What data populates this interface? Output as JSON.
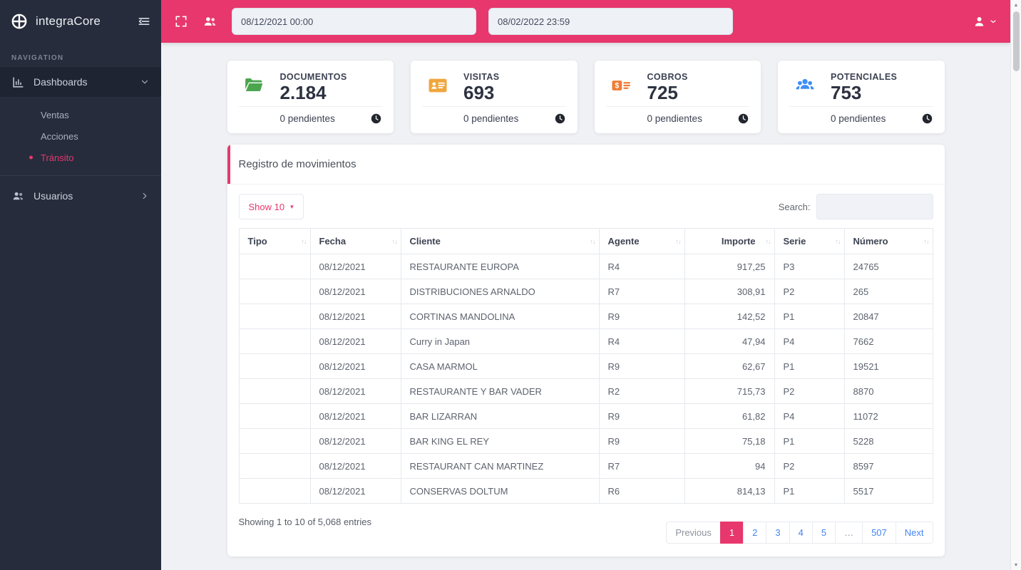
{
  "colors": {
    "accent": "#e7376c",
    "sidebar": "#262c3c",
    "green": "#4ba64f",
    "amber": "#f0a63c",
    "orange": "#ee7d35",
    "blue": "#3e8ef7",
    "link": "#4285f4"
  },
  "sidebar": {
    "brand": "integraCore",
    "section_label": "NAVIGATION",
    "dashboards": {
      "label": "Dashboards"
    },
    "submenu": [
      {
        "label": "Ventas"
      },
      {
        "label": "Acciones"
      },
      {
        "label": "Tránsito"
      }
    ],
    "usuarios": {
      "label": "Usuarios"
    }
  },
  "topbar": {
    "date_from": "08/12/2021 00:00",
    "date_to": "08/02/2022 23:59"
  },
  "stats": [
    {
      "title": "DOCUMENTOS",
      "value": "2.184",
      "pending": "0 pendientes",
      "icon": "folder-icon"
    },
    {
      "title": "VISITAS",
      "value": "693",
      "pending": "0 pendientes",
      "icon": "id-card-icon"
    },
    {
      "title": "COBROS",
      "value": "725",
      "pending": "0 pendientes",
      "icon": "money-icon"
    },
    {
      "title": "POTENCIALES",
      "value": "753",
      "pending": "0 pendientes",
      "icon": "users-group-icon"
    }
  ],
  "panel": {
    "title": "Registro de movimientos",
    "show_button": "Show 10",
    "search_label": "Search:",
    "table": {
      "columns": [
        "Tipo",
        "Fecha",
        "Cliente",
        "Agente",
        "Importe",
        "Serie",
        "Número"
      ],
      "rows": [
        [
          "",
          "08/12/2021",
          "RESTAURANTE EUROPA",
          "R4",
          "917,25",
          "P3",
          "24765"
        ],
        [
          "",
          "08/12/2021",
          "DISTRIBUCIONES ARNALDO",
          "R7",
          "308,91",
          "P2",
          "265"
        ],
        [
          "",
          "08/12/2021",
          "CORTINAS MANDOLINA",
          "R9",
          "142,52",
          "P1",
          "20847"
        ],
        [
          "",
          "08/12/2021",
          "Curry in Japan",
          "R4",
          "47,94",
          "P4",
          "7662"
        ],
        [
          "",
          "08/12/2021",
          "CASA MARMOL",
          "R9",
          "62,67",
          "P1",
          "19521"
        ],
        [
          "",
          "08/12/2021",
          "RESTAURANTE Y BAR VADER",
          "R2",
          "715,73",
          "P2",
          "8870"
        ],
        [
          "",
          "08/12/2021",
          "BAR LIZARRAN",
          "R9",
          "61,82",
          "P4",
          "11072"
        ],
        [
          "",
          "08/12/2021",
          "BAR KING EL REY",
          "R9",
          "75,18",
          "P1",
          "5228"
        ],
        [
          "",
          "08/12/2021",
          "RESTAURANT CAN MARTINEZ",
          "R7",
          "94",
          "P2",
          "8597"
        ],
        [
          "",
          "08/12/2021",
          "CONSERVAS DOLTUM",
          "R6",
          "814,13",
          "P1",
          "5517"
        ]
      ]
    },
    "entries_text": "Showing 1 to 10 of 5,068 entries",
    "pagination": {
      "previous": "Previous",
      "pages": [
        "1",
        "2",
        "3",
        "4",
        "5"
      ],
      "ellipsis": "…",
      "last": "507",
      "next": "Next"
    }
  }
}
